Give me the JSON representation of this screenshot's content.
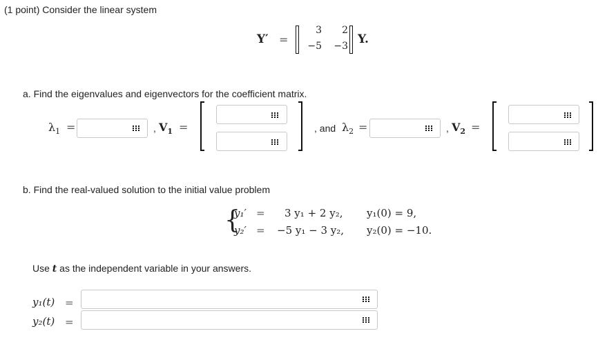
{
  "intro": "(1 point) Consider the linear system",
  "system": {
    "lhs": "Y′",
    "eq": "=",
    "matrix": [
      [
        "3",
        "2"
      ],
      [
        "−5",
        "−3"
      ]
    ],
    "rhs": "Y."
  },
  "part_a": {
    "text": "a. Find the eigenvalues and eigenvectors for the coefficient matrix.",
    "lambda1_sym": "λ",
    "lambda1_sub": "1",
    "eq": "=",
    "comma": ",",
    "v1_sym": "V",
    "v1_sub": "1",
    "and_text": ", and",
    "lambda2_sym": "λ",
    "lambda2_sub": "2",
    "v2_sym": "V",
    "v2_sub": "2",
    "lambda1_value": "",
    "v1_top": "",
    "v1_bottom": "",
    "lambda2_value": "",
    "v2_top": "",
    "v2_bottom": ""
  },
  "part_b": {
    "text": "b. Find the real-valued solution to the initial value problem",
    "eq1_lhs": "y₁′",
    "eq2_lhs": "y₂′",
    "eq": "=",
    "eq1_rhs": "3 y₁ + 2 y₂,",
    "eq2_rhs": "−5 y₁ − 3 y₂,",
    "ic1": "y₁(0) = 9,",
    "ic2": "y₂(0) = −10."
  },
  "use_text_before": "Use",
  "use_var": "t",
  "use_text_after": "as the independent variable in your answers.",
  "answers": {
    "y1_label": "y₁(t)",
    "y2_label": "y₂(t)",
    "eq": "=",
    "y1_value": "",
    "y2_value": ""
  },
  "icons": {
    "matrix_entry": "grid-icon"
  }
}
